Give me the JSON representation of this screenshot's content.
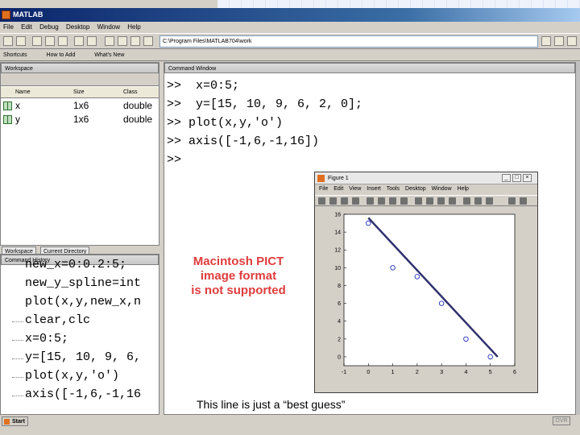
{
  "app": {
    "title": "MATLAB"
  },
  "menu": [
    "File",
    "Edit",
    "Debug",
    "Desktop",
    "Window",
    "Help"
  ],
  "toolbar": {
    "current_dir": "C:\\Program Files\\MATLAB704\\work"
  },
  "shortcuts": [
    "Shortcuts",
    "How to Add",
    "What's New"
  ],
  "workspace": {
    "title": "Workspace",
    "columns": [
      "Name",
      "Size",
      "Class"
    ],
    "rows": [
      {
        "name": "x",
        "size": "1x6",
        "class": "double"
      },
      {
        "name": "y",
        "size": "1x6",
        "class": "double"
      }
    ]
  },
  "tabs": [
    "Workspace",
    "Current Directory"
  ],
  "history": {
    "title": "Command History",
    "lines": [
      "new_x=0:0.2:5;",
      "new_y_spline=int",
      "plot(x,y,new_x,n",
      "clear,clc",
      "x=0:5;",
      "y=[15, 10, 9, 6,",
      "plot(x,y,'o')",
      "axis([-1,6,-1,16"
    ]
  },
  "command": {
    "title": "Command Window",
    "lines": [
      ">>  x=0:5;",
      ">>  y=[15, 10, 9, 6, 2, 0];",
      ">> plot(x,y,'o')",
      ">> axis([-1,6,-1,16])",
      ">>"
    ],
    "pict_notice": [
      "Macintosh PICT",
      "image format",
      "is not supported"
    ],
    "caption": "This line is just a “best guess”"
  },
  "figure": {
    "title": "Figure 1",
    "menu": [
      "File",
      "Edit",
      "View",
      "Insert",
      "Tools",
      "Desktop",
      "Window",
      "Help"
    ]
  },
  "status": {
    "start": "Start",
    "ovr": "OVR"
  },
  "chart_data": {
    "type": "scatter",
    "x": [
      0,
      1,
      2,
      3,
      4,
      5
    ],
    "y": [
      15,
      10,
      9,
      6,
      2,
      0
    ],
    "marker": "o",
    "xlim": [
      -1,
      6
    ],
    "ylim": [
      -1,
      16
    ],
    "xticks": [
      "-1",
      "0",
      "1",
      "2",
      "3",
      "4",
      "5",
      "6"
    ],
    "yticks": [
      "0",
      "2",
      "4",
      "6",
      "8",
      "10",
      "12",
      "14",
      "16"
    ],
    "fit_line": {
      "x": [
        0,
        5.3
      ],
      "y": [
        15.6,
        0
      ]
    },
    "colors": {
      "marker": "#2030c0",
      "line": "#30306e"
    }
  }
}
